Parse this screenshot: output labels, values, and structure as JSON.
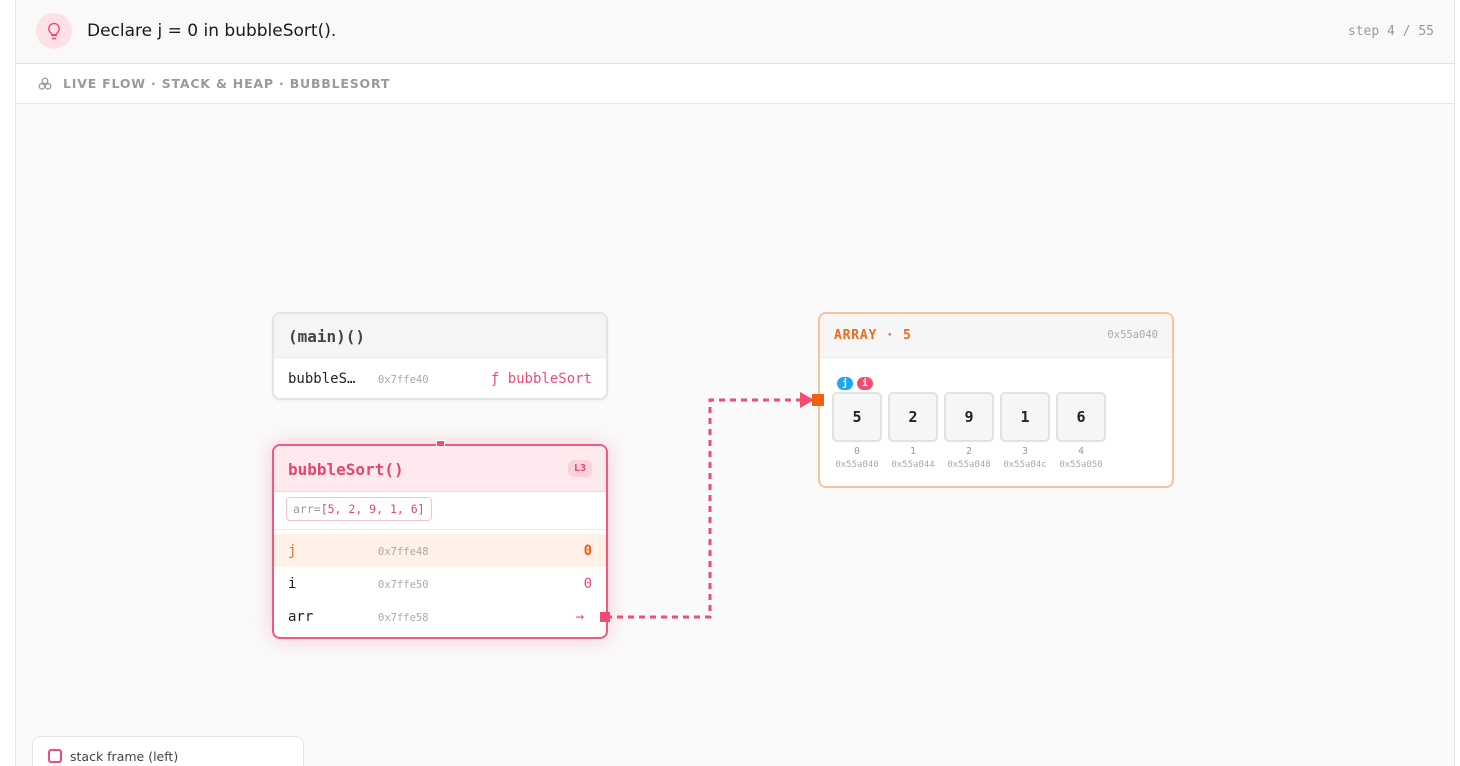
{
  "header": {
    "title": "Declare j = 0 in bubbleSort().",
    "step": "step 4 / 55",
    "icon": "lightbulb-icon"
  },
  "subheader": {
    "title": "LIVE FLOW · STACK & HEAP · BUBBLESORT",
    "icon": "cubes-icon"
  },
  "main_frame": {
    "title": "(main)()",
    "rows": [
      {
        "name": "bubbleS…",
        "addr": "0x7ffe40",
        "value": "ƒ bubbleSort"
      }
    ]
  },
  "bubble_frame": {
    "title": "bubbleSort()",
    "line": "L3",
    "arg": {
      "name": "arr=",
      "value": "[5, 2, 9, 1, 6]"
    },
    "rows": [
      {
        "name": "j",
        "addr": "0x7ffe48",
        "value": "0"
      },
      {
        "name": "i",
        "addr": "0x7ffe50",
        "value": "0"
      },
      {
        "name": "arr",
        "addr": "0x7ffe58",
        "value": "→"
      }
    ]
  },
  "array": {
    "title": "ARRAY · 5",
    "addr": "0x55a040",
    "pointers": [
      "j",
      "i"
    ],
    "cells": [
      {
        "value": "5",
        "index": "0",
        "addr": "0x55a040"
      },
      {
        "value": "2",
        "index": "1",
        "addr": "0x55a044"
      },
      {
        "value": "9",
        "index": "2",
        "addr": "0x55a048"
      },
      {
        "value": "1",
        "index": "3",
        "addr": "0x55a04c"
      },
      {
        "value": "6",
        "index": "4",
        "addr": "0x55a050"
      }
    ]
  },
  "legend": {
    "items": [
      {
        "label": "stack frame (left)"
      }
    ]
  },
  "colors": {
    "accent": "#ef4d72",
    "array_accent": "#ee6a1c",
    "pointer_j": "#1ea8f0",
    "pointer_i": "#ef4d72"
  }
}
